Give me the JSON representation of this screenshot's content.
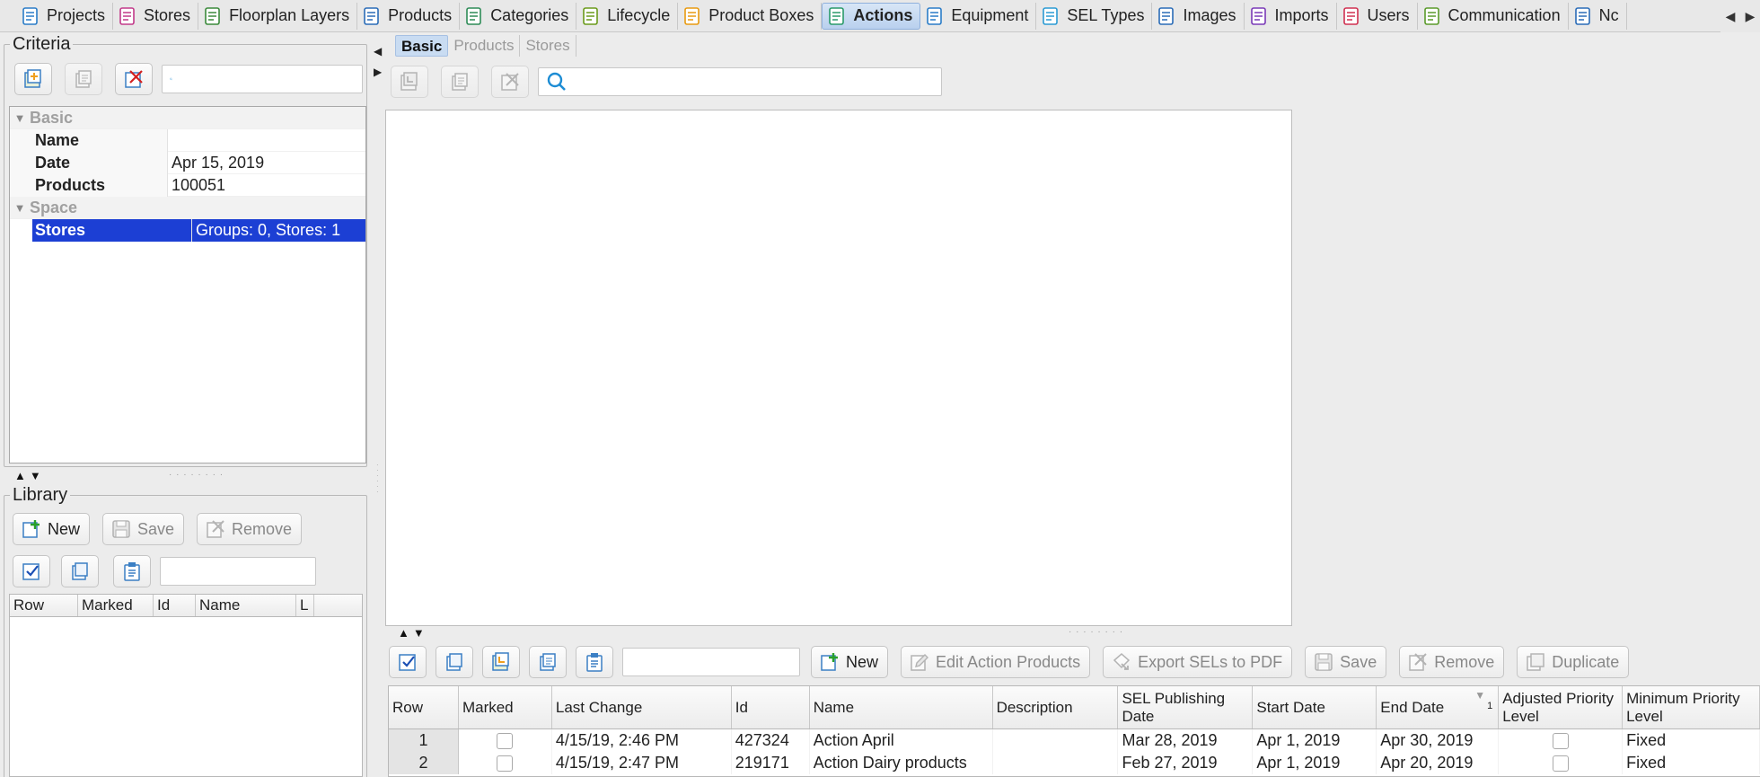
{
  "top_tabs": [
    {
      "label": "Projects",
      "icon": "projects-icon",
      "active": false
    },
    {
      "label": "Stores",
      "icon": "stores-icon",
      "active": false
    },
    {
      "label": "Floorplan Layers",
      "icon": "layers-icon",
      "active": false
    },
    {
      "label": "Products",
      "icon": "products-icon",
      "active": false
    },
    {
      "label": "Categories",
      "icon": "categories-icon",
      "active": false
    },
    {
      "label": "Lifecycle",
      "icon": "lifecycle-icon",
      "active": false
    },
    {
      "label": "Product Boxes",
      "icon": "product-boxes-icon",
      "active": false
    },
    {
      "label": "Actions",
      "icon": "actions-icon",
      "active": true
    },
    {
      "label": "Equipment",
      "icon": "equipment-icon",
      "active": false
    },
    {
      "label": "SEL Types",
      "icon": "sel-types-icon",
      "active": false
    },
    {
      "label": "Images",
      "icon": "images-icon",
      "active": false
    },
    {
      "label": "Imports",
      "icon": "imports-icon",
      "active": false
    },
    {
      "label": "Users",
      "icon": "users-icon",
      "active": false
    },
    {
      "label": "Communication",
      "icon": "communication-icon",
      "active": false
    },
    {
      "label": "Nc",
      "icon": "notifications-icon",
      "active": false
    }
  ],
  "criteria": {
    "title": "Criteria",
    "search_placeholder": "",
    "sections": [
      {
        "label": "Basic",
        "rows": [
          {
            "name": "Name",
            "value": ""
          },
          {
            "name": "Date",
            "value": "Apr 15, 2019"
          },
          {
            "name": "Products",
            "value": "100051"
          }
        ]
      },
      {
        "label": "Space",
        "rows": [
          {
            "name": "Stores",
            "value": "Groups: 0, Stores: 1",
            "selected": true
          }
        ]
      }
    ]
  },
  "library": {
    "title": "Library",
    "new_label": "New",
    "save_label": "Save",
    "remove_label": "Remove",
    "search_placeholder": "",
    "columns": [
      "Row",
      "Marked",
      "Id",
      "Name",
      "L"
    ]
  },
  "sub_tabs": [
    {
      "label": "Basic",
      "active": true
    },
    {
      "label": "Products",
      "active": false
    },
    {
      "label": "Stores",
      "active": false
    }
  ],
  "detail_search_placeholder": "",
  "actions_table": {
    "search_placeholder": "",
    "buttons": {
      "new": "New",
      "edit_products": "Edit Action Products",
      "export_pdf": "Export SELs to PDF",
      "save": "Save",
      "remove": "Remove",
      "duplicate": "Duplicate"
    },
    "columns": [
      {
        "key": "row",
        "label": "Row"
      },
      {
        "key": "marked",
        "label": "Marked"
      },
      {
        "key": "last_change",
        "label": "Last Change"
      },
      {
        "key": "id",
        "label": "Id"
      },
      {
        "key": "name",
        "label": "Name"
      },
      {
        "key": "description",
        "label": "Description"
      },
      {
        "key": "sel_date",
        "label": "SEL Publishing Date"
      },
      {
        "key": "start",
        "label": "Start Date"
      },
      {
        "key": "end",
        "label": "End Date",
        "sort_index": "1"
      },
      {
        "key": "adjusted",
        "label": "Adjusted Priority Level"
      },
      {
        "key": "min_priority",
        "label": "Minimum Priority Level"
      }
    ],
    "rows": [
      {
        "row": "1",
        "marked": false,
        "last_change": "4/15/19, 2:46 PM",
        "id": "427324",
        "name": "Action April",
        "description": "",
        "sel_date": "Mar 28, 2019",
        "start": "Apr 1, 2019",
        "end": "Apr 30, 2019",
        "adjusted": false,
        "min_priority": "Fixed"
      },
      {
        "row": "2",
        "marked": false,
        "last_change": "4/15/19, 2:47 PM",
        "id": "219171",
        "name": "Action Dairy products",
        "description": "",
        "sel_date": "Feb 27, 2019",
        "start": "Apr 1, 2019",
        "end": "Apr 20, 2019",
        "adjusted": false,
        "min_priority": "Fixed"
      }
    ]
  },
  "colors": {
    "accent": "#1c3fd4",
    "active_tab": "#c9dcf2"
  }
}
